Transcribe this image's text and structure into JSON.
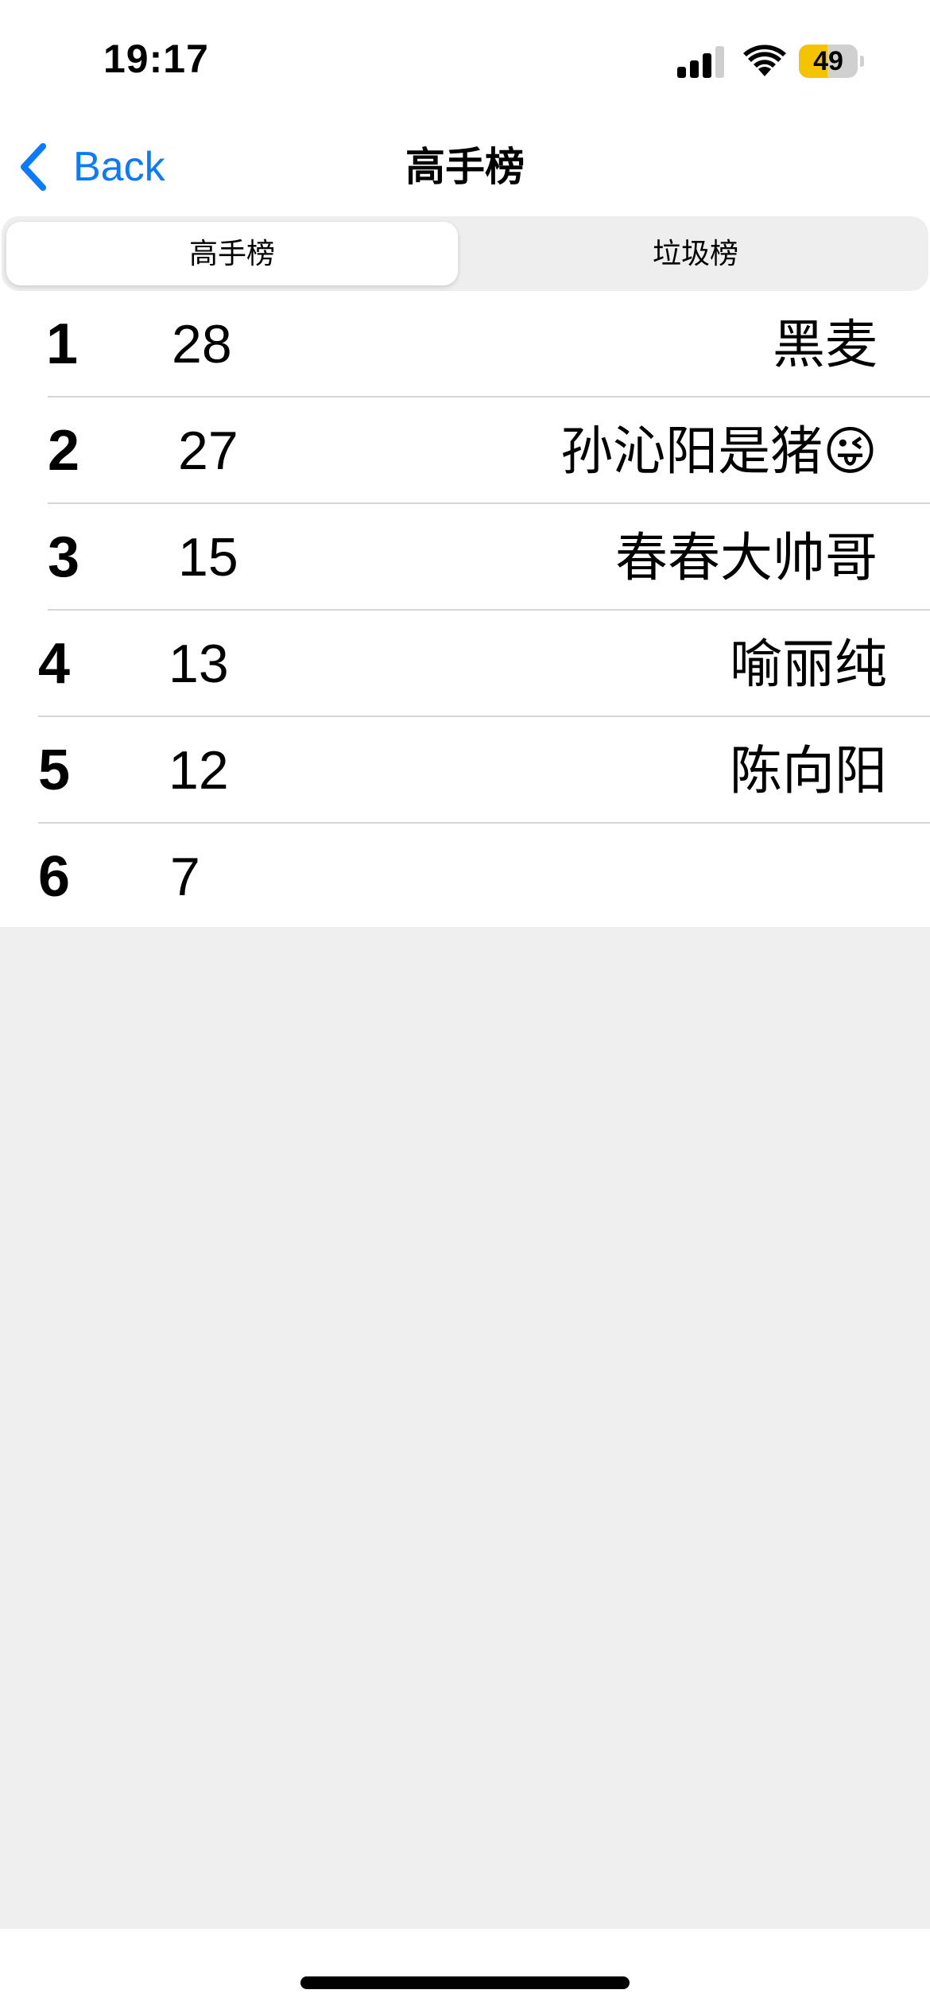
{
  "status_bar": {
    "time": "19:17",
    "battery_level": "49",
    "battery_percent": 49,
    "battery_color": "#f5c400",
    "signal_icon": "cellular-signal-icon",
    "wifi_icon": "wifi-icon"
  },
  "nav": {
    "back_label": "Back",
    "back_icon": "chevron-left-icon",
    "title": "高手榜",
    "accent_color": "#0a7aff"
  },
  "segments": [
    {
      "label": "高手榜",
      "selected": true
    },
    {
      "label": "垃圾榜",
      "selected": false
    }
  ],
  "leaderboard": [
    {
      "rank": "1",
      "score": "28",
      "name": "黑麦"
    },
    {
      "rank": "2",
      "score": "27",
      "name": "孙沁阳是猪😜"
    },
    {
      "rank": "3",
      "score": "15",
      "name": "春春大帅哥"
    },
    {
      "rank": "4",
      "score": "13",
      "name": "喻丽纯"
    },
    {
      "rank": "5",
      "score": "12",
      "name": "陈向阳"
    },
    {
      "rank": "6",
      "score": "7",
      "name": ""
    }
  ]
}
